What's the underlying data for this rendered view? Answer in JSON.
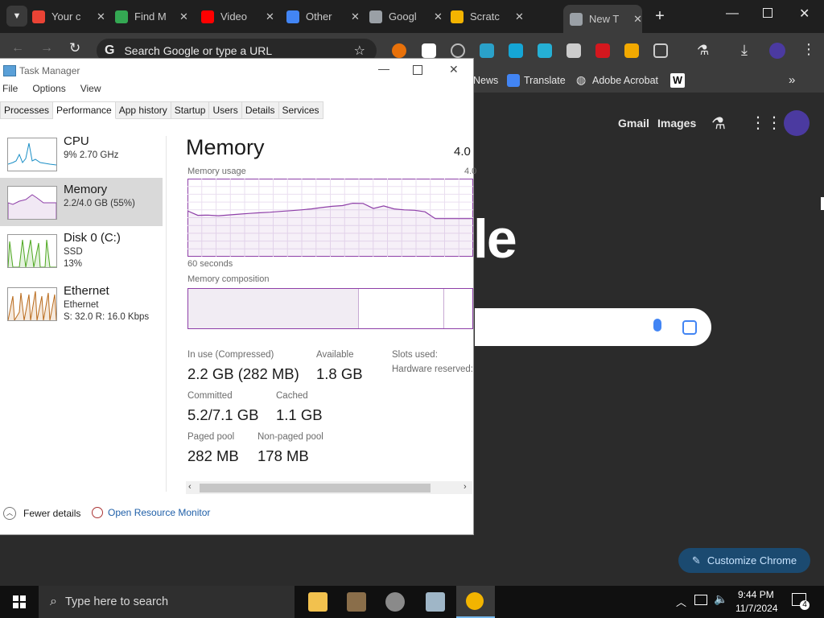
{
  "browser": {
    "tabs": [
      {
        "label": "Your c",
        "favicon_color": "#ea4335"
      },
      {
        "label": "Find M",
        "favicon_color": "#34a853"
      },
      {
        "label": "Video",
        "favicon_color": "#ff0000"
      },
      {
        "label": "Other",
        "favicon_color": "#4285f4"
      },
      {
        "label": "Googl",
        "favicon_color": "#9aa0a6"
      },
      {
        "label": "Scratc",
        "favicon_color": "#f4b400"
      },
      {
        "label": "New T",
        "favicon_color": "#9aa0a6"
      }
    ],
    "new_tab_symbol": "+",
    "tab_close_symbol": "✕",
    "omnibox_placeholder": "Search Google or type a URL",
    "bookmarks": [
      "News",
      "Translate",
      "Adobe Acrobat",
      "W"
    ],
    "ntp": {
      "gmail": "Gmail",
      "images": "Images",
      "logo_fragment": "le",
      "customize_label": "Customize Chrome"
    }
  },
  "task_manager": {
    "title": "Task Manager",
    "menu": [
      "File",
      "Options",
      "View"
    ],
    "tabs": [
      "Processes",
      "Performance",
      "App history",
      "Startup",
      "Users",
      "Details",
      "Services"
    ],
    "active_tab": "Performance",
    "sidebar": [
      {
        "name": "CPU",
        "line1": "9%  2.70 GHz",
        "line2": "",
        "color": "#1b8fc6"
      },
      {
        "name": "Memory",
        "line1": "2.2/4.0 GB (55%)",
        "line2": "",
        "color": "#8e3fa8"
      },
      {
        "name": "Disk 0 (C:)",
        "line1": "SSD",
        "line2": "13%",
        "color": "#4da71f"
      },
      {
        "name": "Ethernet",
        "line1": "Ethernet",
        "line2": "S: 32.0  R: 16.0 Kbps",
        "color": "#b96a1b"
      }
    ],
    "panel": {
      "heading": "Memory",
      "total": "4.0",
      "usage_label": "Memory usage",
      "usage_max": "4.0",
      "time_label": "60 seconds",
      "composition_label": "Memory composition",
      "usage_history_gb": [
        2.35,
        2.12,
        2.13,
        2.1,
        2.14,
        2.18,
        2.22,
        2.25,
        2.28,
        2.32,
        2.36,
        2.4,
        2.45,
        2.52,
        2.58,
        2.62,
        2.74,
        2.73,
        2.47,
        2.6,
        2.45,
        2.4,
        2.38,
        2.3,
        1.95,
        1.95,
        1.95,
        1.95,
        1.95,
        1.95,
        1.95
      ],
      "stats": [
        {
          "label": "In use (Compressed)",
          "value": "2.2 GB (282 MB)"
        },
        {
          "label": "Available",
          "value": "1.8 GB"
        },
        {
          "label": "Slots used:",
          "value": ""
        },
        {
          "label": "Hardware reserved:",
          "value": ""
        },
        {
          "label": "Committed",
          "value": "5.2/7.1 GB"
        },
        {
          "label": "Cached",
          "value": "1.1 GB"
        },
        {
          "label": "Paged pool",
          "value": "282 MB"
        },
        {
          "label": "Non-paged pool",
          "value": "178 MB"
        }
      ]
    },
    "footer": {
      "fewer": "Fewer details",
      "resmon": "Open Resource Monitor"
    }
  },
  "taskbar": {
    "search_placeholder": "Type here to search",
    "time": "9:44 PM",
    "date": "11/7/2024",
    "notifications": "4"
  }
}
